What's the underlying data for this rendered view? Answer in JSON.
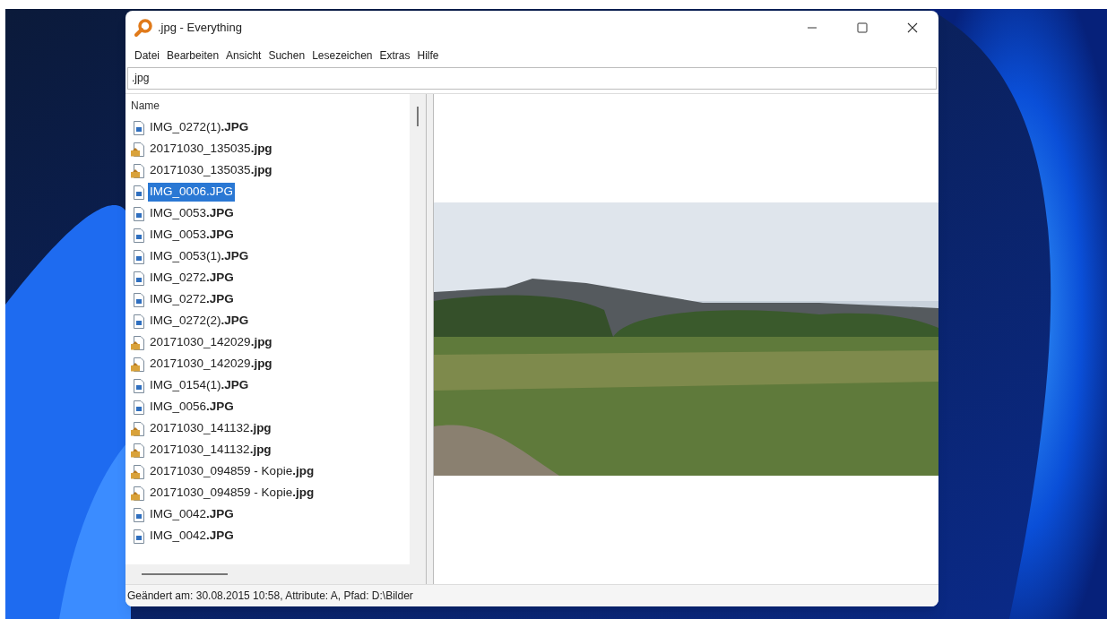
{
  "window": {
    "title": ".jpg - Everything"
  },
  "menu": [
    "Datei",
    "Bearbeiten",
    "Ansicht",
    "Suchen",
    "Lesezeichen",
    "Extras",
    "Hilfe"
  ],
  "search": {
    "value": ".jpg"
  },
  "list": {
    "column": "Name",
    "rows": [
      {
        "name": "IMG_0272(1)**.JPG**",
        "kind": "image",
        "selected": false
      },
      {
        "name": "20171030_135035**.jpg**",
        "kind": "photo",
        "selected": false
      },
      {
        "name": "20171030_135035**.jpg**",
        "kind": "photo",
        "selected": false
      },
      {
        "name": "IMG_0006.JPG",
        "kind": "image",
        "selected": true
      },
      {
        "name": "IMG_0053**.JPG**",
        "kind": "image",
        "selected": false
      },
      {
        "name": "IMG_0053**.JPG**",
        "kind": "image",
        "selected": false
      },
      {
        "name": "IMG_0053(1)**.JPG**",
        "kind": "image",
        "selected": false
      },
      {
        "name": "IMG_0272**.JPG**",
        "kind": "image",
        "selected": false
      },
      {
        "name": "IMG_0272**.JPG**",
        "kind": "image",
        "selected": false
      },
      {
        "name": "IMG_0272(2)**.JPG**",
        "kind": "image",
        "selected": false
      },
      {
        "name": "20171030_142029**.jpg**",
        "kind": "photo",
        "selected": false
      },
      {
        "name": "20171030_142029**.jpg**",
        "kind": "photo",
        "selected": false
      },
      {
        "name": "IMG_0154(1)**.JPG**",
        "kind": "image",
        "selected": false
      },
      {
        "name": "IMG_0056**.JPG**",
        "kind": "image",
        "selected": false
      },
      {
        "name": "20171030_141132**.jpg**",
        "kind": "photo",
        "selected": false
      },
      {
        "name": "20171030_141132**.jpg**",
        "kind": "photo",
        "selected": false
      },
      {
        "name": "20171030_094859 - Kopie**.jpg**",
        "kind": "photo",
        "selected": false
      },
      {
        "name": "20171030_094859 - Kopie**.jpg**",
        "kind": "photo",
        "selected": false
      },
      {
        "name": "IMG_0042**.JPG**",
        "kind": "image",
        "selected": false
      },
      {
        "name": "IMG_0042**.JPG**",
        "kind": "image",
        "selected": false
      }
    ]
  },
  "status_bar": "Geändert am: 30.08.2015 10:58, Attribute: A, Pfad: D:\\Bilder"
}
